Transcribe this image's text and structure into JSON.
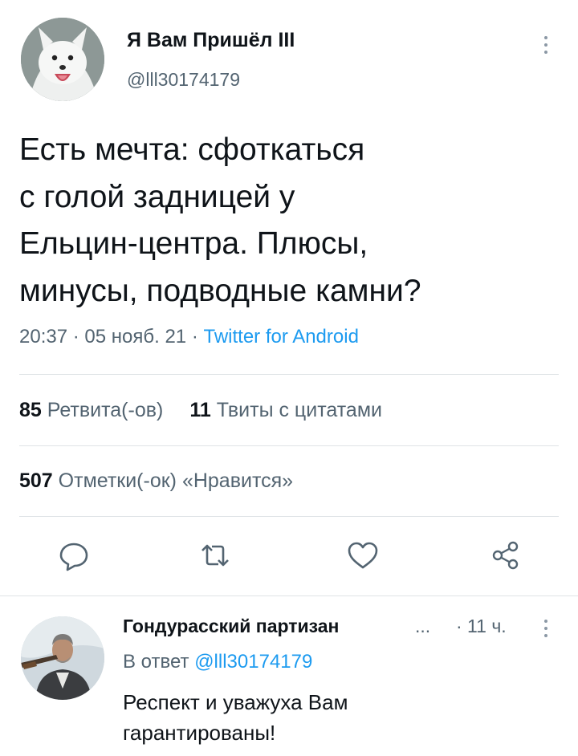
{
  "tweet": {
    "author": {
      "display_name": "Я Вам Пришёл III",
      "handle": "@lll30174179",
      "avatar": "arctic-fox-avatar"
    },
    "text_lines": [
      "Есть мечта: сфоткаться",
      "с голой задницей у",
      "Ельцин-центра. Плюсы,",
      "минусы, подводные камни?"
    ],
    "time": "20:37",
    "sep1": "·",
    "date": "05 нояб. 21",
    "sep2": "·",
    "source": "Twitter for Android",
    "stats": {
      "retweets_count": "85",
      "retweets_label": "Ретвита(-ов)",
      "quotes_count": "11",
      "quotes_label": "Твиты с цитатами",
      "likes_count": "507",
      "likes_label": "Отметки(-ок) «Нравится»"
    },
    "actions": [
      "reply-icon",
      "retweet-icon",
      "like-icon",
      "share-icon"
    ]
  },
  "reply": {
    "display_name": "Гондурасский партизан",
    "ellipsis": "...",
    "time": "· 11 ч.",
    "reply_to_label": "В ответ",
    "reply_to_handle": "@lll30174179",
    "text_lines": [
      "Респект и уважуха Вам",
      "гарантированы!"
    ],
    "avatar": "man-with-rifle-avatar"
  },
  "colors": {
    "text": "#0f1419",
    "secondary": "#536471",
    "accent": "#1d9bf0",
    "divider": "#dfe3e6"
  }
}
